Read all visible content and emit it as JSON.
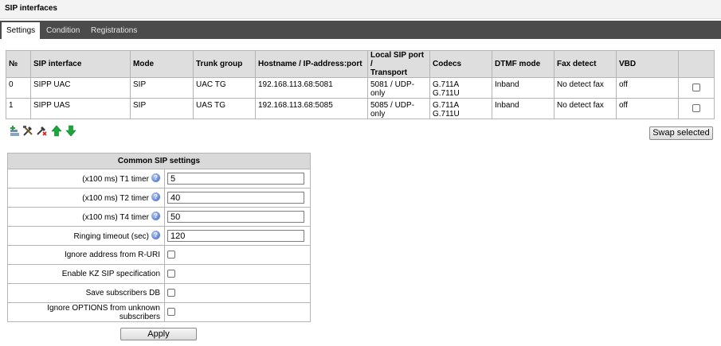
{
  "page": {
    "title": "SIP interfaces"
  },
  "tabs": [
    {
      "label": "Settings",
      "active": true
    },
    {
      "label": "Condition",
      "active": false
    },
    {
      "label": "Registrations",
      "active": false
    }
  ],
  "interfaces_table": {
    "headers": {
      "no": "№",
      "name": "SIP interface",
      "mode": "Mode",
      "trunk": "Trunk group",
      "host_line1": "Hostname / IP-address:port",
      "port_line1": "Local SIP port /",
      "port_line2": "Transport",
      "codecs": "Codecs",
      "dtmf": "DTMF mode",
      "fax": "Fax detect",
      "vbd": "VBD"
    },
    "rows": [
      {
        "no": "0",
        "name": "SIPP UAC",
        "mode": "SIP",
        "trunk": "UAC TG",
        "host": "192.168.113.68:5081",
        "port": "5081 / UDP-only",
        "codec1": "G.711A",
        "codec2": "G.711U",
        "dtmf": "Inband",
        "fax": "No detect fax",
        "vbd": "off",
        "selected": false
      },
      {
        "no": "1",
        "name": "SIPP UAS",
        "mode": "SIP",
        "trunk": "UAS TG",
        "host": "192.168.113.68:5085",
        "port": "5085 / UDP-only",
        "codec1": "G.711A",
        "codec2": "G.711U",
        "dtmf": "Inband",
        "fax": "No detect fax",
        "vbd": "off",
        "selected": false
      }
    ]
  },
  "toolbar": {
    "icons": [
      "add-icon",
      "edit-icon",
      "delete-icon",
      "move-up-icon",
      "move-down-icon"
    ],
    "swap_label": "Swap selected"
  },
  "common": {
    "title": "Common SIP settings",
    "t1_label": "(x100 ms) T1 timer",
    "t1_value": "5",
    "t2_label": "(x100 ms) T2 timer",
    "t2_value": "40",
    "t4_label": "(x100 ms) T4 timer",
    "t4_value": "50",
    "ringing_label": "Ringing timeout (sec)",
    "ringing_value": "120",
    "ignore_ruri_label": "Ignore address from R-URI",
    "kz_label": "Enable KZ SIP specification",
    "save_db_label": "Save subscribers DB",
    "ignore_options_label": "Ignore OPTIONS from unknown subscribers",
    "help_glyph": "?"
  },
  "apply_label": "Apply",
  "colors": {
    "tabbar": "#4b4b4b",
    "header_cell": "#dedede",
    "help_icon": "#3a62c4",
    "arrow": "#1aa83a"
  }
}
